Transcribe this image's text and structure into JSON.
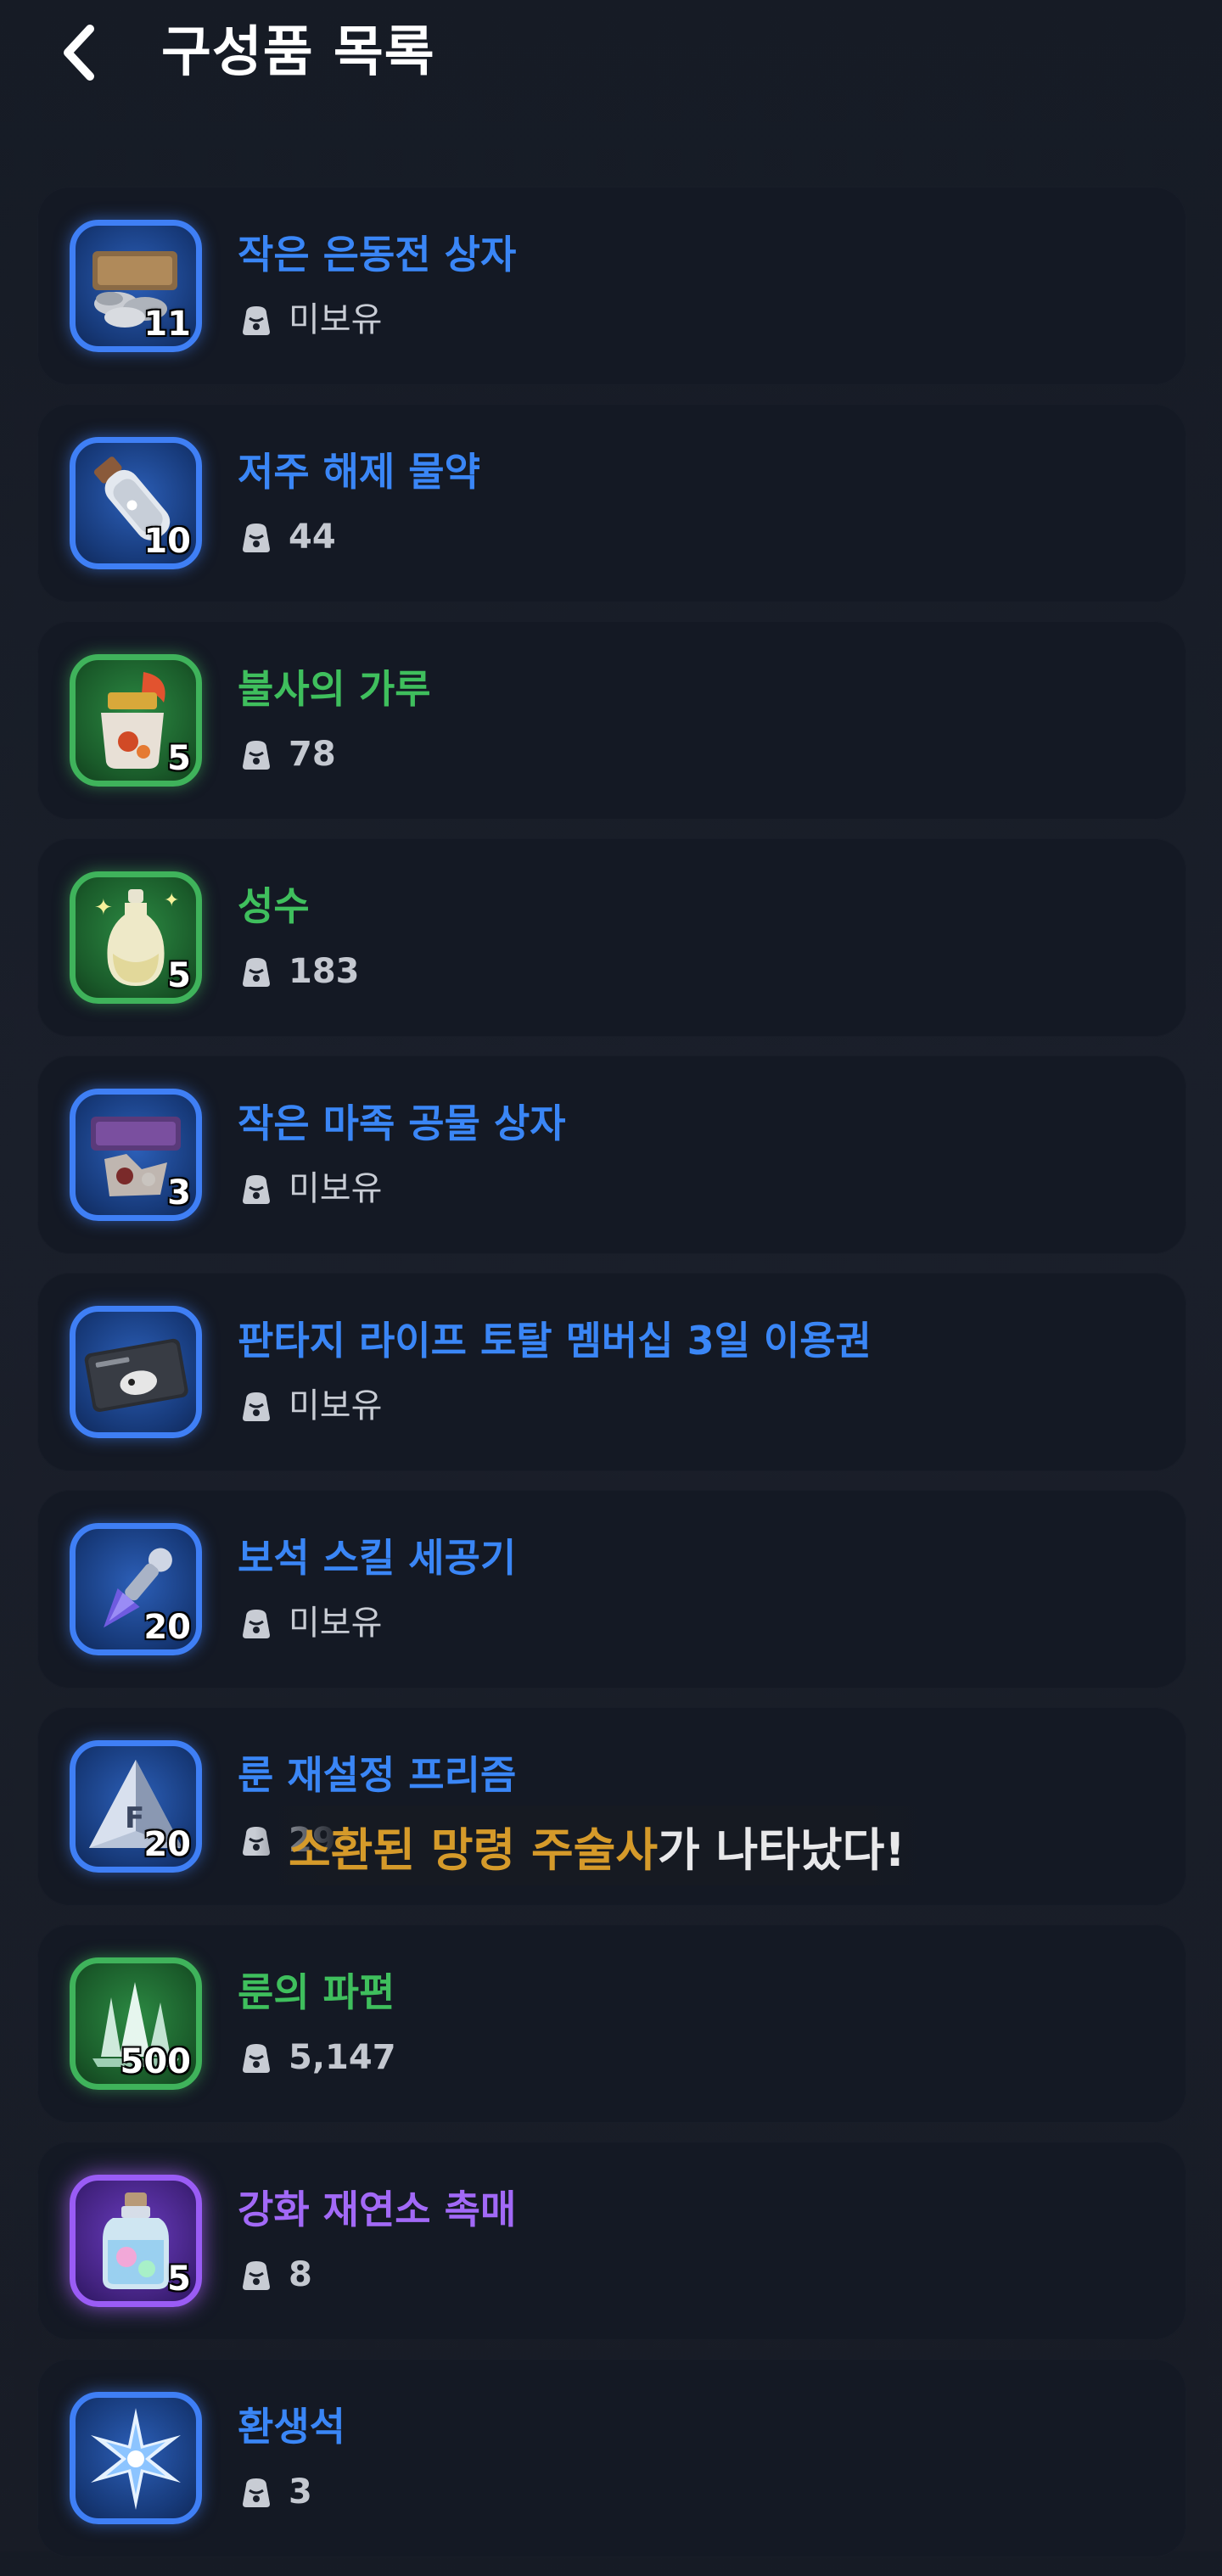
{
  "header": {
    "title": "구성품 목록",
    "back_icon": "chevron-left-icon"
  },
  "items": [
    {
      "name": "작은 은동전 상자",
      "qty": "11",
      "owned": "미보유",
      "rarity": "blue",
      "icon": "coin-box-icon"
    },
    {
      "name": "저주 해제 물약",
      "qty": "10",
      "owned": "44",
      "rarity": "blue",
      "icon": "potion-vial-icon"
    },
    {
      "name": "불사의 가루",
      "qty": "5",
      "owned": "78",
      "rarity": "green",
      "icon": "powder-pouch-icon"
    },
    {
      "name": "성수",
      "qty": "5",
      "owned": "183",
      "rarity": "green",
      "icon": "holy-water-icon"
    },
    {
      "name": "작은 마족 공물 상자",
      "qty": "3",
      "owned": "미보유",
      "rarity": "blue",
      "icon": "demon-tribute-box-icon"
    },
    {
      "name": "판타지 라이프 토탈 멤버십 3일 이용권",
      "qty": "",
      "owned": "미보유",
      "rarity": "blue",
      "icon": "membership-card-icon"
    },
    {
      "name": "보석 스킬 세공기",
      "qty": "20",
      "owned": "미보유",
      "rarity": "blue",
      "icon": "gem-tool-icon"
    },
    {
      "name": "룬 재설정 프리즘",
      "qty": "20",
      "owned": "29",
      "rarity": "blue",
      "icon": "prism-icon"
    },
    {
      "name": "룬의 파편",
      "qty": "500",
      "owned": "5,147",
      "rarity": "green",
      "icon": "rune-shard-icon"
    },
    {
      "name": "강화 재연소 촉매",
      "qty": "5",
      "owned": "8",
      "rarity": "purple",
      "icon": "catalyst-bottle-icon"
    },
    {
      "name": "환생석",
      "qty": "",
      "owned": "3",
      "rarity": "blue",
      "icon": "rebirth-star-icon"
    }
  ],
  "toast": {
    "highlight": "소환된 망령 주술사",
    "rest": "가 나타났다!"
  },
  "colors": {
    "blue": "#3a86f6",
    "green": "#3fbf5d",
    "purple": "#a269f7",
    "toast_highlight": "#d59a2a"
  }
}
